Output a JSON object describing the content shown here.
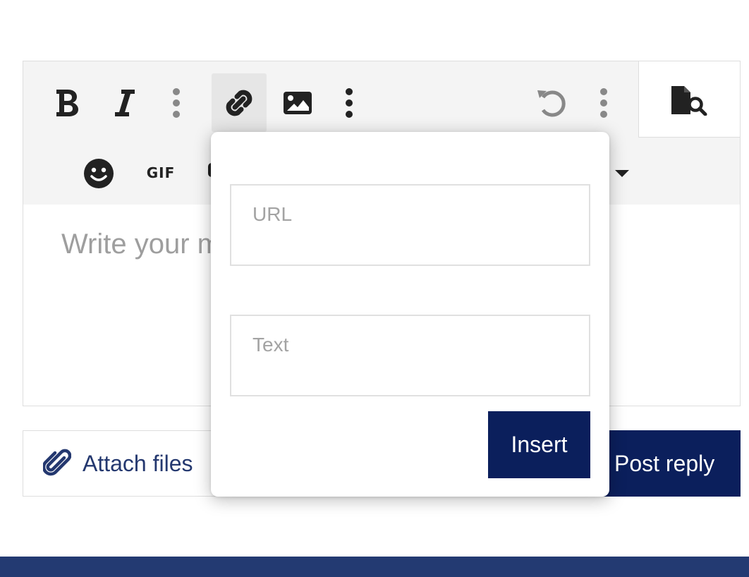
{
  "toolbar": {
    "row1_icons": [
      "bold-icon",
      "italic-icon",
      "more-vertical-icon",
      "link-icon",
      "image-icon",
      "more-vertical-icon",
      "undo-icon",
      "more-vertical-icon",
      "preview-icon"
    ],
    "row2_icons": [
      "smiley-icon",
      "gif-icon",
      "dropdown-caret-icon"
    ],
    "gif_label": "GIF"
  },
  "editor": {
    "placeholder": "Write your message..."
  },
  "link_popup": {
    "url_placeholder": "URL",
    "text_placeholder": "Text",
    "insert_label": "Insert"
  },
  "actions": {
    "attach_label": "Attach files",
    "post_label": "Post reply"
  },
  "colors": {
    "primary": "#0b1f5c",
    "footer": "#233a72",
    "toolbar_bg": "#f4f4f4",
    "link_text": "#24386f"
  }
}
